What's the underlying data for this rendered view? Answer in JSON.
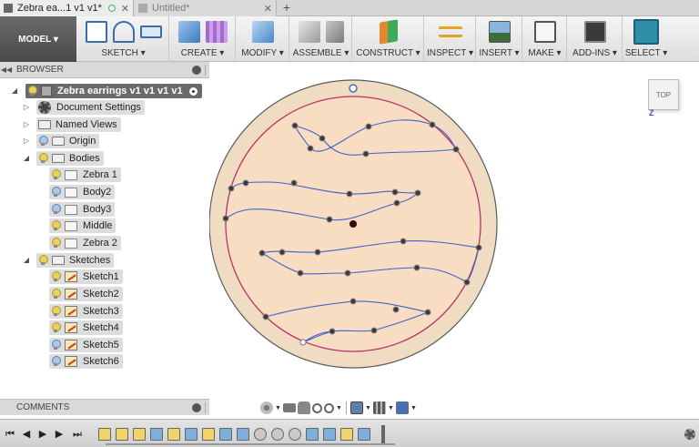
{
  "tabs": [
    {
      "title": "Zebra ea...1 v1 v1*",
      "active": true
    },
    {
      "title": "Untitled*",
      "active": false
    }
  ],
  "workspace": {
    "label": "MODEL ▾"
  },
  "toolbar": {
    "groups": [
      {
        "label": "SKETCH ▾"
      },
      {
        "label": "CREATE ▾"
      },
      {
        "label": "MODIFY ▾"
      },
      {
        "label": "ASSEMBLE ▾"
      },
      {
        "label": "CONSTRUCT ▾"
      },
      {
        "label": "INSPECT ▾"
      },
      {
        "label": "INSERT ▾"
      },
      {
        "label": "MAKE ▾"
      },
      {
        "label": "ADD-INS ▾"
      },
      {
        "label": "SELECT ▾"
      }
    ],
    "icons": [
      "sketch-create-icon",
      "spline-icon",
      "rectangle-icon",
      "box-icon",
      "sculpt-form-icon",
      "press-pull-icon",
      "new-component-icon",
      "joint-icon",
      "offset-plane-icon",
      "measure-icon",
      "insert-image-icon",
      "make-3d-print-icon",
      "scripts-addins-icon",
      "select-icon"
    ]
  },
  "browser": {
    "title": "BROWSER",
    "root": "Zebra earrings v1 v1 v1 v1",
    "items": [
      {
        "label": "Document Settings"
      },
      {
        "label": "Named Views"
      },
      {
        "label": "Origin"
      },
      {
        "label": "Bodies"
      },
      {
        "label": "Zebra 1"
      },
      {
        "label": "Body2"
      },
      {
        "label": "Body3"
      },
      {
        "label": "Middle"
      },
      {
        "label": "Zebra 2"
      },
      {
        "label": "Sketches"
      },
      {
        "label": "Sketch1"
      },
      {
        "label": "Sketch2"
      },
      {
        "label": "Sketch3"
      },
      {
        "label": "Sketch4"
      },
      {
        "label": "Sketch5"
      },
      {
        "label": "Sketch6"
      }
    ]
  },
  "comments": {
    "title": "COMMENTS"
  },
  "viewcube": {
    "face": "TOP",
    "axis_label": "Z"
  },
  "colors": {
    "disc_fill": "#f4dcc0",
    "disc_rim": "#555555",
    "inner_circle": "#b8336a",
    "spline": "#3f62c6",
    "accent": "#2f8fa8"
  }
}
